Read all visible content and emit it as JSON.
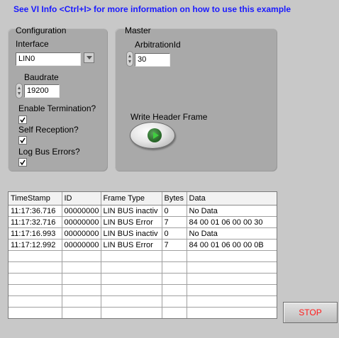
{
  "hint": "See VI Info <Ctrl+I> for more information on how to use this example",
  "configuration": {
    "title": "Configuration",
    "interface_label": "Interface",
    "interface_value": "LIN0",
    "baudrate_label": "Baudrate",
    "baudrate_value": "19200",
    "enable_termination_label": "Enable Termination?",
    "self_reception_label": "Self Reception?",
    "log_bus_errors_label": "Log Bus Errors?",
    "enable_termination_checked": true,
    "self_reception_checked": true,
    "log_bus_errors_checked": true
  },
  "master": {
    "title": "Master",
    "arbitration_label": "ArbitrationId",
    "arbitration_value": "30",
    "write_header_label": "Write Header Frame"
  },
  "table": {
    "headers": [
      "TimeStamp",
      "ID",
      "Frame Type",
      "Bytes",
      "Data"
    ],
    "rows": [
      [
        "11:17:36.716",
        "00000000",
        "LIN BUS inactiv",
        "0",
        "No Data"
      ],
      [
        "11:17:32.716",
        "00000000",
        "LIN BUS Error",
        "7",
        "84 00 01 06 00 00 30"
      ],
      [
        "11:17:16.993",
        "00000000",
        "LIN BUS inactiv",
        "0",
        "No Data"
      ],
      [
        "11:17:12.992",
        "00000000",
        "LIN BUS Error",
        "7",
        "84 00 01 06 00 00 0B"
      ]
    ],
    "empty_rows": 6
  },
  "stop_label": "STOP"
}
